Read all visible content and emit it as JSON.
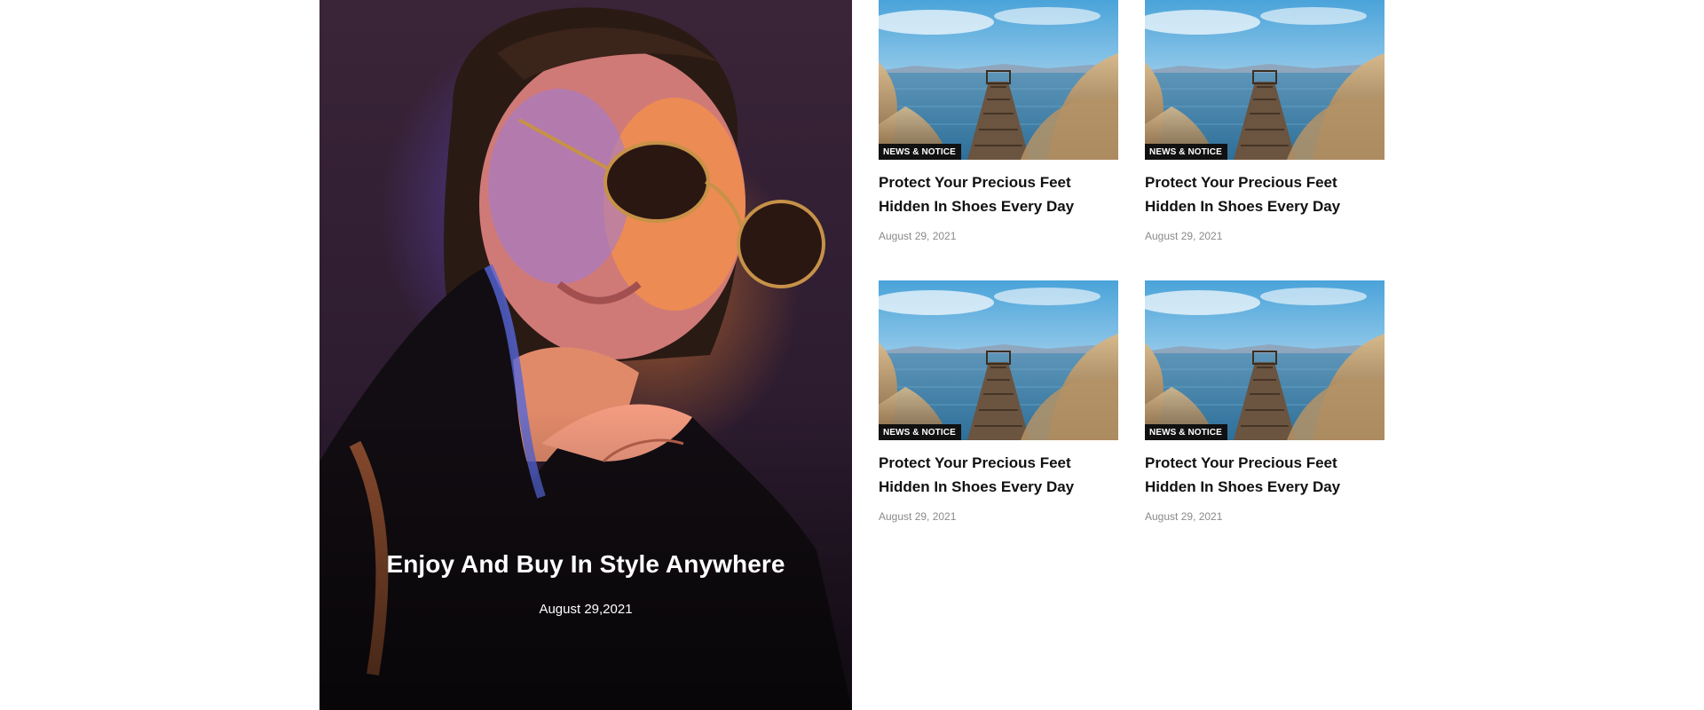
{
  "hero": {
    "title": "Enjoy And Buy In Style Anywhere",
    "date": "August 29,2021"
  },
  "posts": [
    {
      "tag": "NEWS & NOTICE",
      "title": "Protect Your Precious Feet Hidden In Shoes Every Day",
      "date": "August 29, 2021"
    },
    {
      "tag": "NEWS & NOTICE",
      "title": "Protect Your Precious Feet Hidden In Shoes Every Day",
      "date": "August 29, 2021"
    },
    {
      "tag": "NEWS & NOTICE",
      "title": "Protect Your Precious Feet Hidden In Shoes Every Day",
      "date": "August 29, 2021"
    },
    {
      "tag": "NEWS & NOTICE",
      "title": "Protect Your Precious Feet Hidden In Shoes Every Day",
      "date": "August 29, 2021"
    }
  ]
}
